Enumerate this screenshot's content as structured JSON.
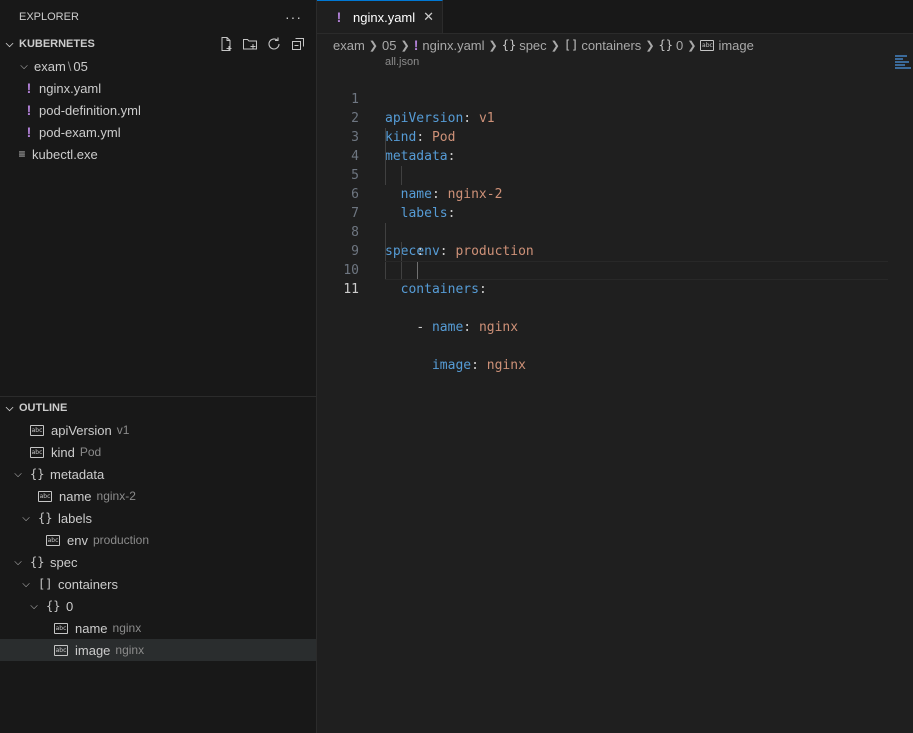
{
  "explorer": {
    "title": "EXPLORER",
    "more": "···",
    "workspace": "KUBERNETES",
    "folder": {
      "name": "exam",
      "sep": "\\",
      "sub": "05"
    },
    "files": [
      "nginx.yaml",
      "pod-definition.yml",
      "pod-exam.yml"
    ],
    "exe": "kubectl.exe"
  },
  "outline": {
    "title": "OUTLINE",
    "items": [
      {
        "name": "apiVersion",
        "desc": "v1"
      },
      {
        "name": "kind",
        "desc": "Pod"
      },
      {
        "name": "metadata",
        "desc": ""
      },
      {
        "name": "name",
        "desc": "nginx-2"
      },
      {
        "name": "labels",
        "desc": ""
      },
      {
        "name": "env",
        "desc": "production"
      },
      {
        "name": "spec",
        "desc": ""
      },
      {
        "name": "containers",
        "desc": ""
      },
      {
        "name": "0",
        "desc": ""
      },
      {
        "name": "name",
        "desc": "nginx"
      },
      {
        "name": "image",
        "desc": "nginx"
      }
    ]
  },
  "tab": {
    "label": "nginx.yaml",
    "close": "✕"
  },
  "breadcrumb": [
    "exam",
    "05",
    "nginx.yaml",
    "spec",
    "containers",
    "0",
    "image"
  ],
  "schema_hint": "all.json",
  "code": {
    "line_numbers": [
      "1",
      "2",
      "3",
      "4",
      "5",
      "6",
      "7",
      "8",
      "9",
      "10",
      "11"
    ],
    "lines": [
      {
        "k": "apiVersion",
        "v": "v1"
      },
      {
        "k": "kind",
        "v": "Pod"
      },
      {
        "k": "metadata",
        "v": ""
      },
      {
        "k": "name",
        "v": "nginx-2"
      },
      {
        "k": "labels",
        "v": ""
      },
      {
        "k": "env",
        "v": "production"
      },
      {
        "k": "",
        "v": ""
      },
      {
        "k": "spec",
        "v": ""
      },
      {
        "k": "containers",
        "v": ""
      },
      {
        "dash": "- ",
        "k": "name",
        "v": "nginx"
      },
      {
        "k": "image",
        "v": "nginx"
      }
    ],
    "colon": ":"
  },
  "colors": {
    "key": "#569cd6",
    "value": "#ce9178",
    "yaml_icon": "#b180d7",
    "accent": "#0078d4"
  }
}
